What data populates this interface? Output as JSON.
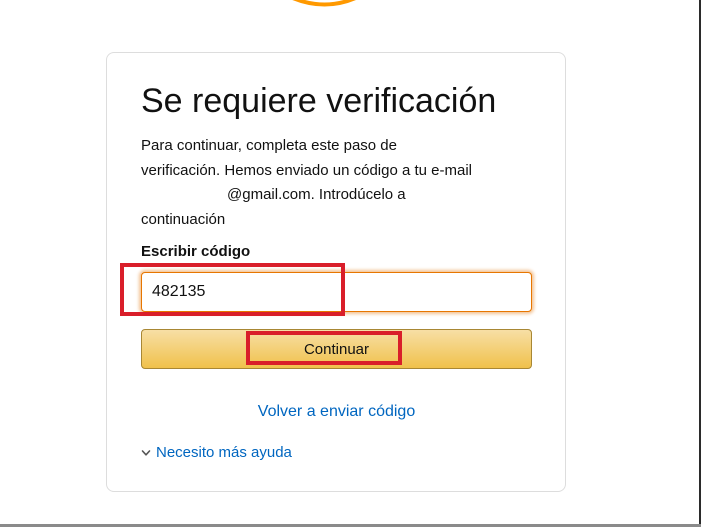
{
  "colors": {
    "logo_accent": "#f90",
    "link": "#0066c0",
    "button_yellow": "#f0c14b",
    "input_focus": "#e77600",
    "highlight_red": "#d91e2a"
  },
  "header": {
    "logo_icon": "amazon-smile-arc-icon"
  },
  "verification": {
    "title": "Se requiere verificación",
    "description_line1": "Para continuar, completa este paso de",
    "description_line2": "verificación. Hemos enviado un código a tu e-mail",
    "description_line3": "@gmail.com. Introdúcelo a",
    "description_line4": "continuación",
    "code_label": "Escribir código",
    "code_value": "482135",
    "continue_label": "Continuar",
    "resend_label": "Volver a enviar código",
    "help_label": "Necesito más ayuda",
    "help_icon": "chevron-down-icon"
  }
}
